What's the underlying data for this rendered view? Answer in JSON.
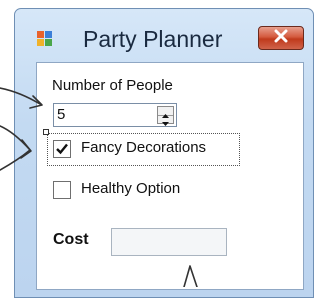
{
  "window": {
    "title": "Party Planner",
    "close_icon": "close-icon",
    "app_icon": "app-window-icon"
  },
  "form": {
    "people_label": "Number of People",
    "people_value": "5",
    "fancy_label": "Fancy Decorations",
    "fancy_checked": true,
    "healthy_label": "Healthy Option",
    "healthy_checked": false,
    "cost_label": "Cost",
    "cost_value": ""
  },
  "colors": {
    "title_bar": "#c3daf2",
    "close_button": "#c9452a",
    "annotation_arrow": "#333333"
  }
}
